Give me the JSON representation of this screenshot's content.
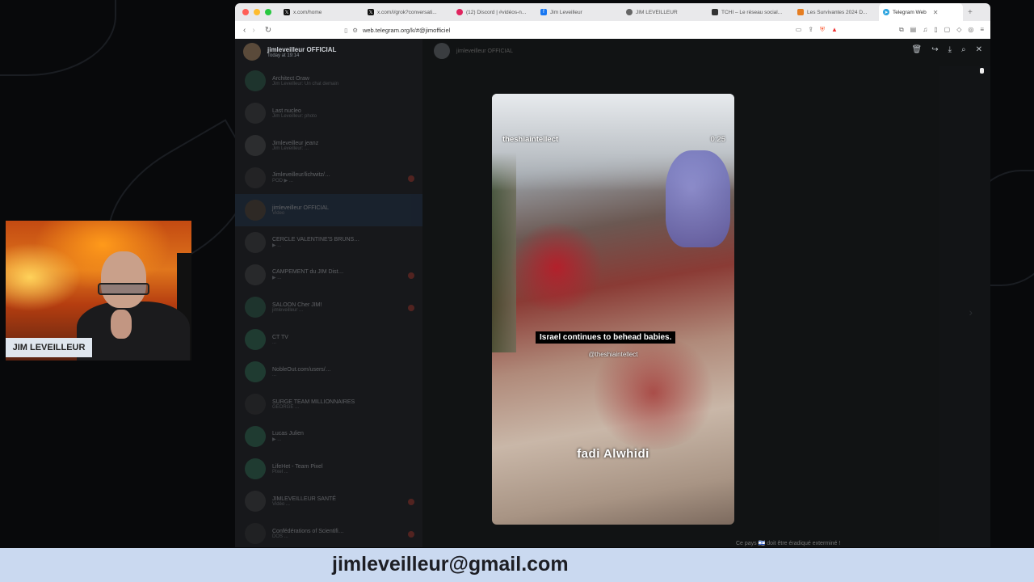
{
  "browser": {
    "tabs": [
      {
        "label": "x.com/home",
        "icon": "x-logo-icon",
        "color": "#111111"
      },
      {
        "label": "x.com/i/grok?conversati...",
        "icon": "x-logo-icon",
        "color": "#111111"
      },
      {
        "label": "(12) Discord | #vidéos-n...",
        "icon": "discord-icon",
        "color": "#e0245e"
      },
      {
        "label": "Jim Leveilleur",
        "icon": "facebook-icon",
        "color": "#1877f2"
      },
      {
        "label": "JIM LEVEILLEUR",
        "icon": "person-icon",
        "color": "#666666"
      },
      {
        "label": "TCHI – Le réseau social...",
        "icon": "tchi-icon",
        "color": "#333333"
      },
      {
        "label": "Les Survivantes 2024 D...",
        "icon": "doc-icon",
        "color": "#e67e22"
      },
      {
        "label": "Telegram Web",
        "icon": "telegram-icon",
        "color": "#2aa3df",
        "active": true
      }
    ],
    "url": "web.telegram.org/k/#@jimofficiel"
  },
  "telegram": {
    "profile": {
      "name": "jimleveilleur OFFICIAL",
      "status": "Today at 19:14"
    },
    "chats": [
      {
        "name": "Architect Oraw",
        "preview": "Jim Leveilleur: Un chat demain",
        "avatar_color": "#2d6a4f"
      },
      {
        "name": "Last nucleo",
        "preview": "Jim Leveilleur: photo",
        "avatar_color": "#444444"
      },
      {
        "name": "Jimleveilleur jeanz",
        "preview": "Jim Leveilleur: ...",
        "avatar_color": "#555555"
      },
      {
        "name": "Jimleveilleur/lichwitz/…",
        "preview": "POD ▶ ...",
        "avatar_color": "#3a3a3a",
        "badge": true
      },
      {
        "name": "jimleveilleur OFFICIAL",
        "preview": "Video",
        "avatar_color": "#5a4a3a",
        "selected": true
      },
      {
        "name": "CERCLE VALENTINE'S BRUNS…",
        "preview": "▶ ...",
        "avatar_color": "#444444"
      },
      {
        "name": "CAMPEMENT du JIM Dist…",
        "preview": "▶ ...",
        "avatar_color": "#4a4a4a",
        "badge": true
      },
      {
        "name": "SALOON Cher JIM!",
        "preview": "jimleveilleur ...",
        "avatar_color": "#2d6a4f",
        "badge": true
      },
      {
        "name": "CT TV",
        "preview": "...",
        "avatar_color": "#2e7d5b"
      },
      {
        "name": "NobleOut.com/users/…",
        "preview": "...",
        "avatar_color": "#2e7d5b"
      },
      {
        "name": "SURGE TEAM MILLIONNAIRES",
        "preview": "GEORGE ...",
        "avatar_color": "#333333"
      },
      {
        "name": "Lucas Julien",
        "preview": "▶ ...",
        "avatar_color": "#2e7d5b"
      },
      {
        "name": "LifeHet - Team Pixel",
        "preview": "Pixel ...",
        "avatar_color": "#2e7d5b"
      },
      {
        "name": "JIMLEVEILLEUR SANTÉ",
        "preview": "Vidéo ...",
        "avatar_color": "#444444",
        "badge": true
      },
      {
        "name": "Confédérations of Scientifi…",
        "preview": "DOS ...",
        "avatar_color": "#333333",
        "badge": true
      }
    ],
    "bottom_caption": "Ce pays 🇮🇱 doit être éradiqué exterminé !"
  },
  "video": {
    "watermark": "theshiaintellect",
    "timestamp": "0:25",
    "subtitle": "Israel continues to behead babies.",
    "handle": "@theshiaintellect",
    "name": "fadi Alwhidi"
  },
  "webcam": {
    "label": "JIM LEVEILLEUR"
  },
  "footer": {
    "email": "jimleveilleur@gmail.com"
  }
}
